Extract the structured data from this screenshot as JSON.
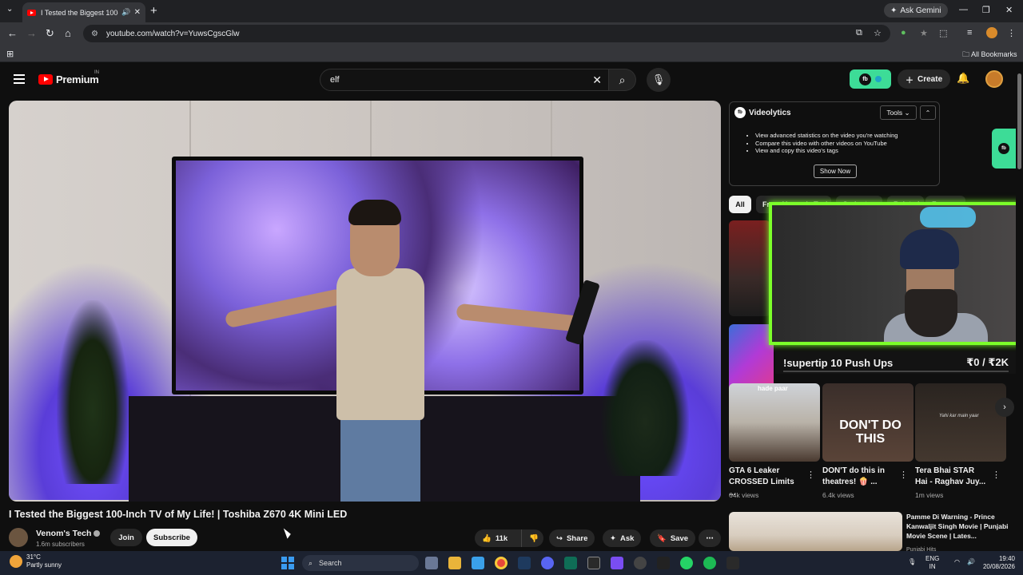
{
  "browser": {
    "tab_title": "I Tested the Biggest 100-Inch",
    "url": "youtube.com/watch?v=YuwsCgscGlw",
    "gemini_label": "Ask Gemini",
    "bookmarks_label": "All Bookmarks"
  },
  "youtube": {
    "logo": "Premium",
    "country_code": "IN",
    "search_value": "elf",
    "create_label": "Create",
    "videolytics_badge": "fb"
  },
  "video": {
    "title": "I Tested the Biggest 100-Inch TV of My Life! | Toshiba Z670 4K Mini LED",
    "channel": "Venom's Tech",
    "subscribers": "1.6m subscribers",
    "join": "Join",
    "subscribe": "Subscribe",
    "likes": "11k",
    "share": "Share",
    "ask": "Ask",
    "save": "Save"
  },
  "videolytics": {
    "name": "Videolytics",
    "tools": "Tools",
    "bullets": [
      "View advanced statistics on the video you're watching",
      "Compare this video with other videos on YouTube",
      "View and copy this video's tags"
    ],
    "cta": "Show Now"
  },
  "chips": [
    "All",
    "From Venom's Tech",
    "Gadgets",
    "Related",
    "For you"
  ],
  "overlay": {
    "superchat_text": "!supertip 10 Push Ups",
    "superchat_amount": "₹0 / ₹2K"
  },
  "cards": [
    {
      "title": "GTA 6 Leaker CROSSED Limits ...",
      "meta": "64k views",
      "overlay": "hade paar"
    },
    {
      "title": "DON'T do this in theatres! 🍿 ...",
      "meta": "6.4k views",
      "overlay": "DON'T DO THIS"
    },
    {
      "title": "Tera Bhai STAR Hai - Raghav Juy...",
      "meta": "1m views",
      "overlay": "Yahi kar main yaar"
    }
  ],
  "bottom_card": {
    "title": "Pamme Di Warning - Prince Kanwaljit Singh Movie | Punjabi Movie Scene | Lates...",
    "meta": "Punjabi Hits"
  },
  "taskbar": {
    "temp": "31°C",
    "weather": "Partly sunny",
    "search": "Search",
    "lang": "ENG",
    "region": "IN",
    "time": "19:40",
    "date": "20/08/2026"
  },
  "colors": {
    "youtube_red": "#ff0000",
    "videolytics_green": "#3ddc97",
    "overlay_green": "#7cff2a"
  }
}
